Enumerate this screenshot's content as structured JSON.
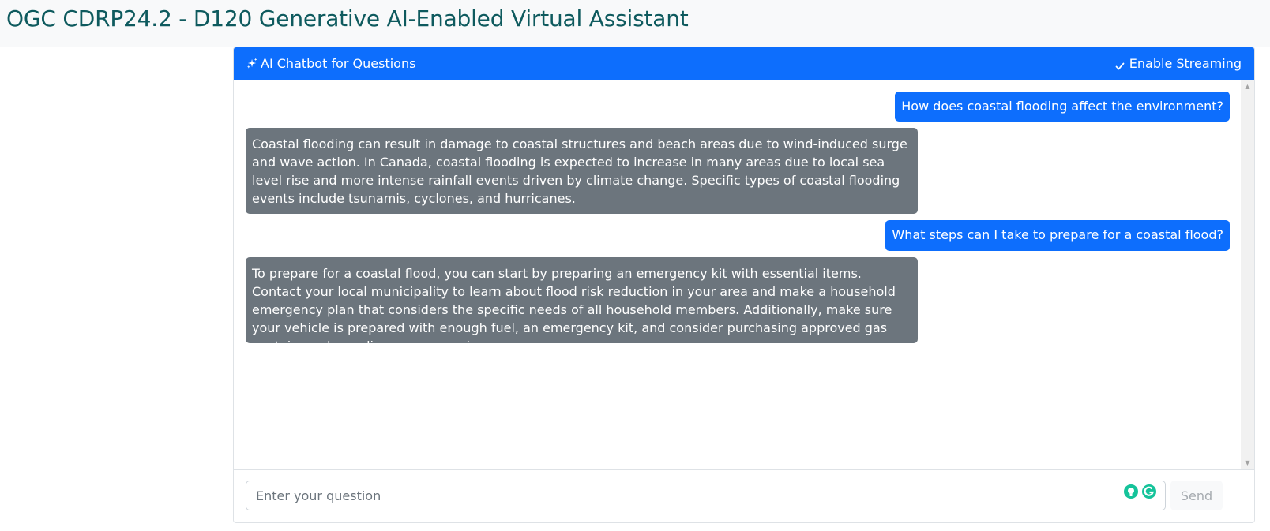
{
  "page": {
    "title": "OGC CDRP24.2 - D120 Generative AI-Enabled Virtual Assistant"
  },
  "chat": {
    "header_title": "AI Chatbot for Questions",
    "streaming_label": "Enable Streaming",
    "streaming_enabled": true,
    "messages": [
      {
        "role": "user",
        "text": "How does coastal flooding affect the environment?"
      },
      {
        "role": "assistant",
        "text": "Coastal flooding can result in damage to coastal structures and beach areas due to wind-induced surge and wave action. In Canada, coastal flooding is expected to increase in many areas due to local sea level rise and more intense rainfall events driven by climate change. Specific types of coastal flooding events include tsunamis, cyclones, and hurricanes."
      },
      {
        "role": "user",
        "text": "What steps can I take to prepare for a coastal flood?"
      },
      {
        "role": "assistant",
        "text": "To prepare for a coastal flood, you can start by preparing an emergency kit with essential items. Contact your local municipality to learn about flood risk reduction in your area and make a household emergency plan that considers the specific needs of all household members. Additionally, make sure your vehicle is prepared with enough fuel, an emergency kit, and consider purchasing approved gas containers depending on your region."
      }
    ],
    "input": {
      "placeholder": "Enter your question",
      "value": ""
    },
    "send_label": "Send"
  },
  "colors": {
    "title": "#0e5a5e",
    "header_bg": "#0d6efd",
    "user_bubble": "#0d6efd",
    "assistant_bubble": "#6c757d"
  },
  "icons": {
    "header": "sparkles-icon",
    "streaming": "check-icon",
    "input_extensions": [
      "grammar-suggestion-icon",
      "grammarly-icon"
    ]
  }
}
